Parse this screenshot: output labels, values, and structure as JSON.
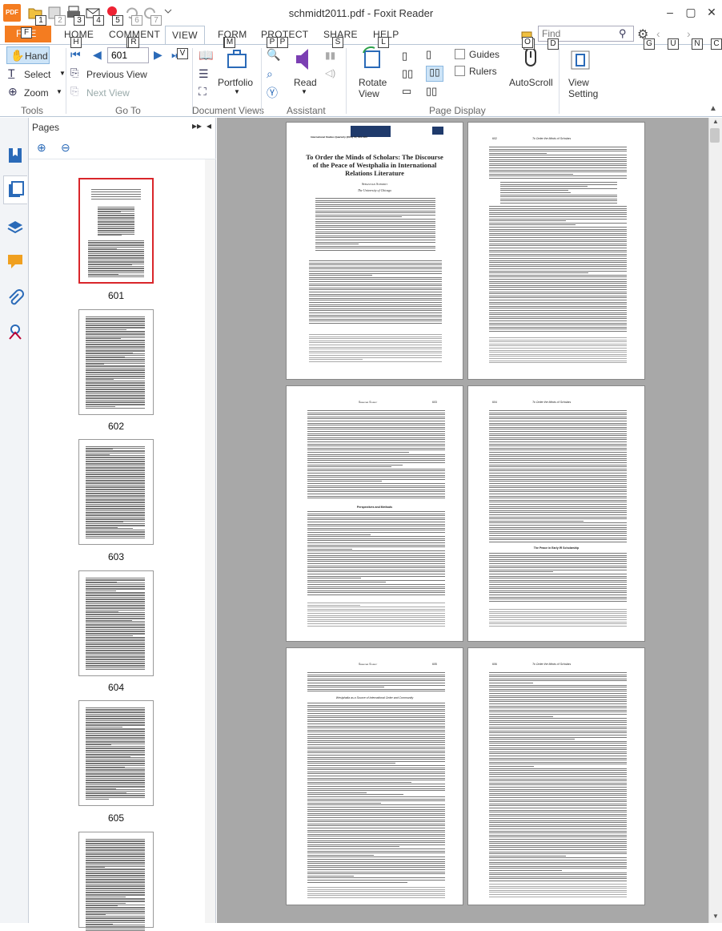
{
  "window": {
    "title": "schmidt2011.pdf - Foxit Reader",
    "app_logo_text": "PDF"
  },
  "quick_access": {
    "keytips": [
      "1",
      "2",
      "3",
      "4",
      "5",
      "6",
      "7"
    ]
  },
  "tabs": [
    {
      "label": "FILE",
      "key": "F"
    },
    {
      "label": "HOME",
      "key": "H"
    },
    {
      "label": "COMMENT",
      "key": "R"
    },
    {
      "label": "VIEW",
      "key": "V"
    },
    {
      "label": "FORM",
      "key": "M"
    },
    {
      "label": "PROTECT",
      "key": "P"
    },
    {
      "label": "SHARE",
      "key": "S"
    },
    {
      "label": "HELP",
      "key": "L"
    }
  ],
  "search": {
    "placeholder": "Find",
    "key_q": "Q",
    "key_d": "D"
  },
  "right_keytips": [
    "G",
    "U",
    "N",
    "C"
  ],
  "ribbon": {
    "tools": {
      "hand": "Hand",
      "select": "Select",
      "zoom": "Zoom",
      "label": "Tools"
    },
    "goto": {
      "page_value": "601",
      "previous_view": "Previous View",
      "next_view": "Next View",
      "label": "Go To"
    },
    "docviews": {
      "portfolio": "Portfolio",
      "label": "Document Views"
    },
    "assistant": {
      "read": "Read",
      "label": "Assistant"
    },
    "pagedisplay": {
      "rotate_view": "Rotate View",
      "guides": "Guides",
      "rulers": "Rulers",
      "autoscroll": "AutoScroll",
      "view_setting": "View Setting",
      "label": "Page Display"
    }
  },
  "pages_panel": {
    "title": "Pages",
    "thumbnails": [
      {
        "label": "601",
        "selected": true
      },
      {
        "label": "602",
        "selected": false
      },
      {
        "label": "603",
        "selected": false
      },
      {
        "label": "604",
        "selected": false
      },
      {
        "label": "605",
        "selected": false
      }
    ]
  },
  "document": {
    "page1": {
      "journal_header": "International Studies Quarterly (2011) 55, 601–623",
      "title": "To Order the Minds of Scholars: The Discourse of the Peace of Westphalia in International Relations Literature",
      "author": "Sebastian Schmidt",
      "affiliation": "The University of Chicago"
    },
    "page2_header": {
      "num": "602",
      "text": "To Order the Minds of Scholars"
    },
    "page3_header": {
      "num": "603",
      "text": "Sebastian Schmidt"
    },
    "page4_header": {
      "num": "604",
      "text": "To Order the Minds of Scholars"
    },
    "page4_heading": "The Peace in Early IR Scholarship",
    "page3_heading": "Perspectives and Methods",
    "page5_header": {
      "num": "605",
      "text": "Sebastian Schmidt"
    },
    "page5_heading": "Westphalia as a Source of International Order and Community",
    "page6_header": {
      "num": "606",
      "text": "To Order the Minds of Scholars"
    }
  }
}
